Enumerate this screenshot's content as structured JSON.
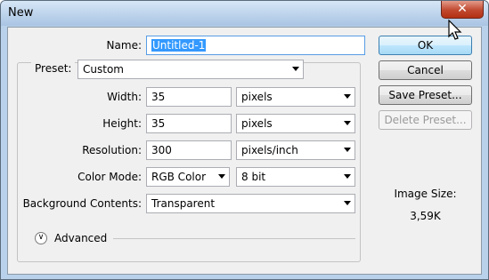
{
  "window": {
    "title": "New",
    "close_glyph": "✕"
  },
  "form": {
    "name": {
      "label": "Name:",
      "value": "Untitled-1"
    },
    "preset": {
      "label": "Preset:",
      "value": "Custom"
    },
    "width": {
      "label": "Width:",
      "value": "35",
      "unit": "pixels"
    },
    "height": {
      "label": "Height:",
      "value": "35",
      "unit": "pixels"
    },
    "resolution": {
      "label": "Resolution:",
      "value": "300",
      "unit": "pixels/inch"
    },
    "color_mode": {
      "label": "Color Mode:",
      "value": "RGB Color",
      "depth": "8 bit"
    },
    "background": {
      "label": "Background Contents:",
      "value": "Transparent"
    },
    "advanced": {
      "label": "Advanced",
      "icon": "chevron-double-down-icon"
    }
  },
  "buttons": {
    "ok": "OK",
    "cancel": "Cancel",
    "save_preset": "Save Preset...",
    "delete_preset": "Delete Preset..."
  },
  "info": {
    "image_size_label": "Image Size:",
    "image_size_value": "3,59K"
  },
  "colors": {
    "accent": "#3399ff",
    "titlebar": "#b9d1ea",
    "close": "#c0492f"
  }
}
